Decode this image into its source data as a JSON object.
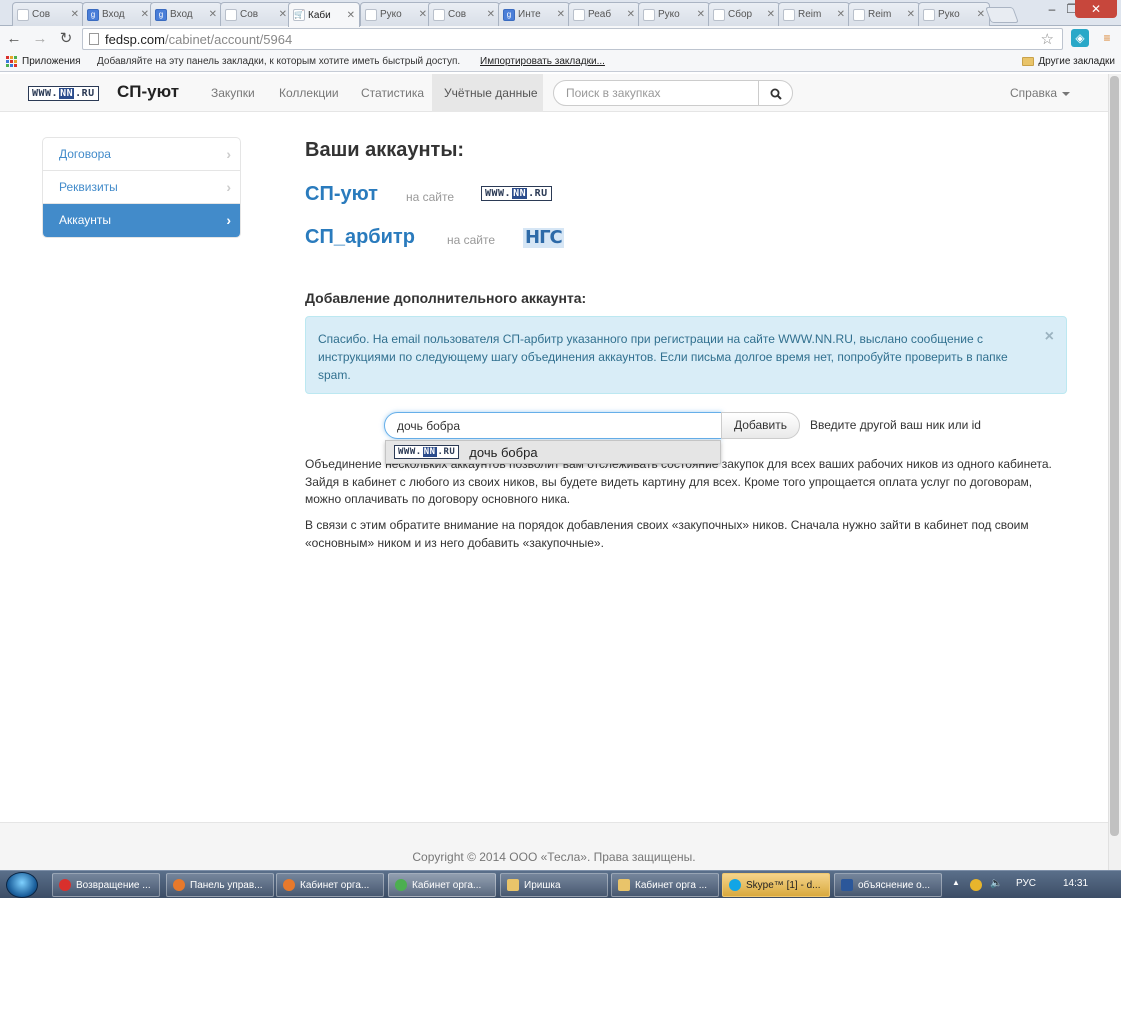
{
  "browser": {
    "tabs": [
      {
        "label": "Сов",
        "icon": "page-icon"
      },
      {
        "label": "Вход",
        "icon": "google-plus-icon"
      },
      {
        "label": "Вход",
        "icon": "google-plus-icon"
      },
      {
        "label": "Сов",
        "icon": "page-icon"
      },
      {
        "label": "Каби",
        "icon": "cart-icon",
        "active": true
      },
      {
        "label": "Руко",
        "icon": "page-icon"
      },
      {
        "label": "Сов",
        "icon": "page-icon"
      },
      {
        "label": "Инте",
        "icon": "google-plus-icon"
      },
      {
        "label": "Реаб",
        "icon": "blank-page-icon"
      },
      {
        "label": "Руко",
        "icon": "page-icon"
      },
      {
        "label": "Сбор",
        "icon": "page-icon"
      },
      {
        "label": "Reim",
        "icon": "page-icon"
      },
      {
        "label": "Reim",
        "icon": "page-icon"
      },
      {
        "label": "Руко",
        "icon": "page-icon"
      }
    ],
    "url_host": "fedsp.com",
    "url_path": "/cabinet/account/5964",
    "bookmarks": {
      "apps_label": "Приложения",
      "hint": "Добавляйте на эту панель закладки, к которым хотите иметь быстрый доступ.",
      "import_link": "Импортировать закладки...",
      "other_label": "Другие закладки"
    }
  },
  "site": {
    "logo_text_pre": "WWW.",
    "logo_text_nn": "NN",
    "logo_text_post": ".RU",
    "brand": "СП-уют",
    "nav": [
      {
        "label": "Закупки"
      },
      {
        "label": "Коллекции"
      },
      {
        "label": "Статистика"
      },
      {
        "label": "Учётные данные",
        "active": true
      }
    ],
    "search_placeholder": "Поиск в закупках",
    "help_label": "Справка"
  },
  "sidebar": {
    "items": [
      {
        "label": "Договора",
        "active": false
      },
      {
        "label": "Реквизиты",
        "active": false
      },
      {
        "label": "Аккаунты",
        "active": true
      }
    ]
  },
  "main": {
    "title": "Ваши аккаунты:",
    "accounts": [
      {
        "name": "СП-уют",
        "site_label": "на сайте",
        "site": "WWW.NN.RU"
      },
      {
        "name": "СП_арбитр",
        "site_label": "на сайте",
        "site": "НГС"
      }
    ],
    "add_title": "Добавление дополнительного аккаунта:",
    "alert_text": "Спасибо. На email пользователя СП-арбитр указанного при регистрации на сайте WWW.NN.RU, выслано сообщение с инструкциями по следующему шагу объединения аккаунтов. Если письма долгое время нет, попробуйте проверить в папке spam.",
    "alert_close": "×",
    "nick_value": "дочь бобра",
    "add_button": "Добавить",
    "hint": "Введите другой ваш ник или id",
    "autocomplete_value": "дочь бобра",
    "para1": "Объединение нескольких аккаунтов позволит вам отслеживать состояние закупок для всех ваших рабочих ников из одного кабинета. Зайдя в кабинет с любого из своих ников, вы будете видеть картину для всех. Кроме того упрощается оплата услуг по договорам, можно оплачивать по договору основного ника.",
    "para2": "В связи с этим обратите внимание на порядок добавления своих «закупочных» ников. Сначала нужно зайти в кабинет под своим «основным» ником и из него добавить «закупочные»."
  },
  "footer": {
    "copyright": "Copyright © 2014 ООО «Тесла». Права защищены."
  },
  "taskbar": {
    "tasks": [
      {
        "label": "Возвращение ...",
        "icon": "opera-icon",
        "color": "#d9302c"
      },
      {
        "label": "Панель управ...",
        "icon": "firefox-icon",
        "color": "#e8792b"
      },
      {
        "label": "Кабинет орга...",
        "icon": "firefox-icon",
        "color": "#e8792b"
      },
      {
        "label": "Кабинет орга...",
        "icon": "chrome-icon",
        "color": "#4caf50",
        "current": true
      },
      {
        "label": "Иришка",
        "icon": "folder-icon",
        "color": "#e9c46a"
      },
      {
        "label": "Кабинет орга ...",
        "icon": "folder-icon",
        "color": "#e9c46a"
      },
      {
        "label": "Skype™ [1] - d...",
        "icon": "skype-icon",
        "color": "#12a5e6",
        "highlight": true
      },
      {
        "label": "объяснение о...",
        "icon": "word-icon",
        "color": "#2b579a"
      }
    ],
    "lang": "РУС",
    "time": "14:31"
  }
}
